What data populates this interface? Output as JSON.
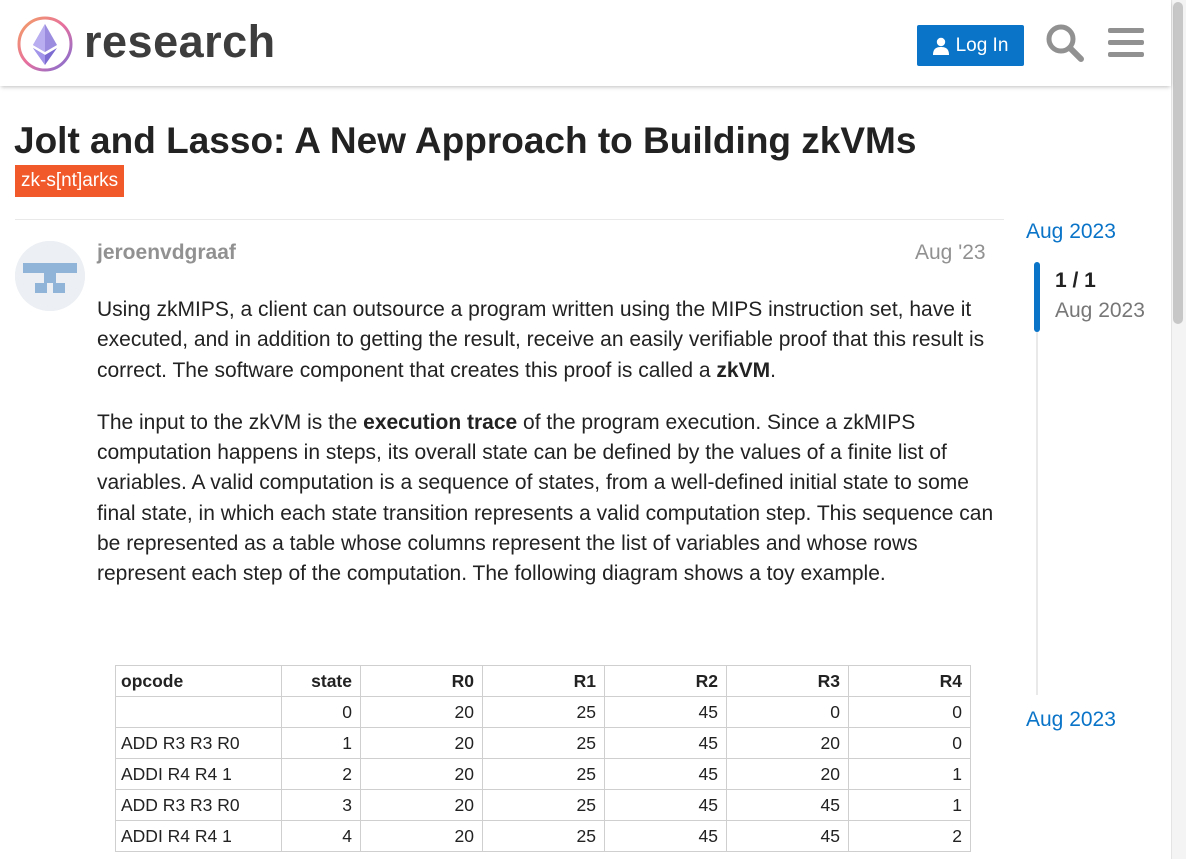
{
  "site": {
    "logo_text": "research",
    "login_label": "Log In"
  },
  "topic": {
    "title": "Jolt and Lasso: A New Approach to Building zkVMs",
    "tag": "zk-s[nt]arks"
  },
  "post": {
    "author": "jeroenvdgraaf",
    "date": "Aug '23",
    "p1_before": "Using zkMIPS, a client can outsource a program written using the MIPS instruction set, have it executed, and in addition to getting the result, receive an easily verifiable proof that this result is correct. The software component that creates this proof is called a ",
    "p1_bold": "zkVM",
    "p1_after": ".",
    "p2_before": "The input to the zkVM is the ",
    "p2_bold": "execution trace",
    "p2_after": " of the program execution. Since a zkMIPS computation happens in steps, its overall state can be defined by the values of a finite list of variables. A valid computation is a sequence of states, from a well-defined initial state to some final state, in which each state transition represents a valid computation step. This sequence can be represented as a table whose columns represent the list of variables and whose rows represent each step of the computation. The following diagram shows a toy example."
  },
  "trace_table": {
    "headers": [
      "opcode",
      "state",
      "R0",
      "R1",
      "R2",
      "R3",
      "R4"
    ],
    "rows": [
      [
        "",
        "0",
        "20",
        "25",
        "45",
        "0",
        "0"
      ],
      [
        "ADD R3 R3 R0",
        "1",
        "20",
        "25",
        "45",
        "20",
        "0"
      ],
      [
        "ADDI R4 R4 1",
        "2",
        "20",
        "25",
        "45",
        "20",
        "1"
      ],
      [
        "ADD R3 R3 R0",
        "3",
        "20",
        "25",
        "45",
        "45",
        "1"
      ],
      [
        "ADDI R4 R4 1",
        "4",
        "20",
        "25",
        "45",
        "45",
        "2"
      ]
    ]
  },
  "timeline": {
    "start_date": "Aug 2023",
    "position": "1 / 1",
    "position_date": "Aug 2023",
    "end_date": "Aug 2023"
  },
  "colors": {
    "accent": "#0a74c8",
    "tag": "#f1592a",
    "muted": "#919191"
  }
}
